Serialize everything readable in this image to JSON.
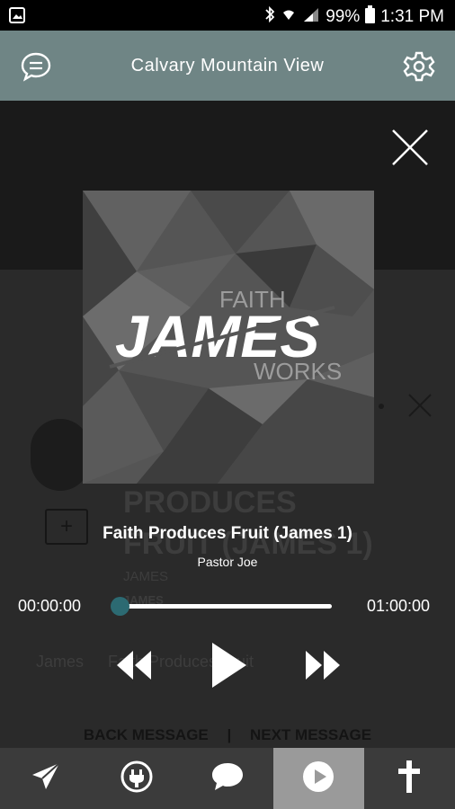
{
  "status_bar": {
    "battery": "99%",
    "time": "1:31 PM"
  },
  "header": {
    "title": "Calvary Mountain View"
  },
  "background_page": {
    "title_line1": "PRODUCES",
    "title_line2": "FRUIT (JAMES 1)",
    "series": "JAMES",
    "speaker": "JAMES",
    "breadcrumb_series": "James",
    "breadcrumb_message": "Faith Produces Fruit",
    "back_label": "BACK MESSAGE",
    "separator": "|",
    "next_label": "NEXT MESSAGE"
  },
  "artwork": {
    "word_faith": "FAITH",
    "word_james": "JAMES",
    "word_works": "WORKS"
  },
  "player": {
    "track_title": "Faith Produces Fruit (James 1)",
    "artist": "Pastor Joe",
    "elapsed": "00:00:00",
    "duration": "01:00:00",
    "progress": 0
  },
  "tabs": [
    {
      "icon": "send-icon"
    },
    {
      "icon": "plug-icon"
    },
    {
      "icon": "chat-bubble-icon"
    },
    {
      "icon": "play-circle-icon",
      "active": true
    },
    {
      "icon": "cross-icon"
    }
  ],
  "colors": {
    "header_bg": "#6f8585",
    "accent": "#2c6a72",
    "tabbar_bg": "#3b3b3b",
    "tab_active_bg": "#9a9a9a"
  }
}
